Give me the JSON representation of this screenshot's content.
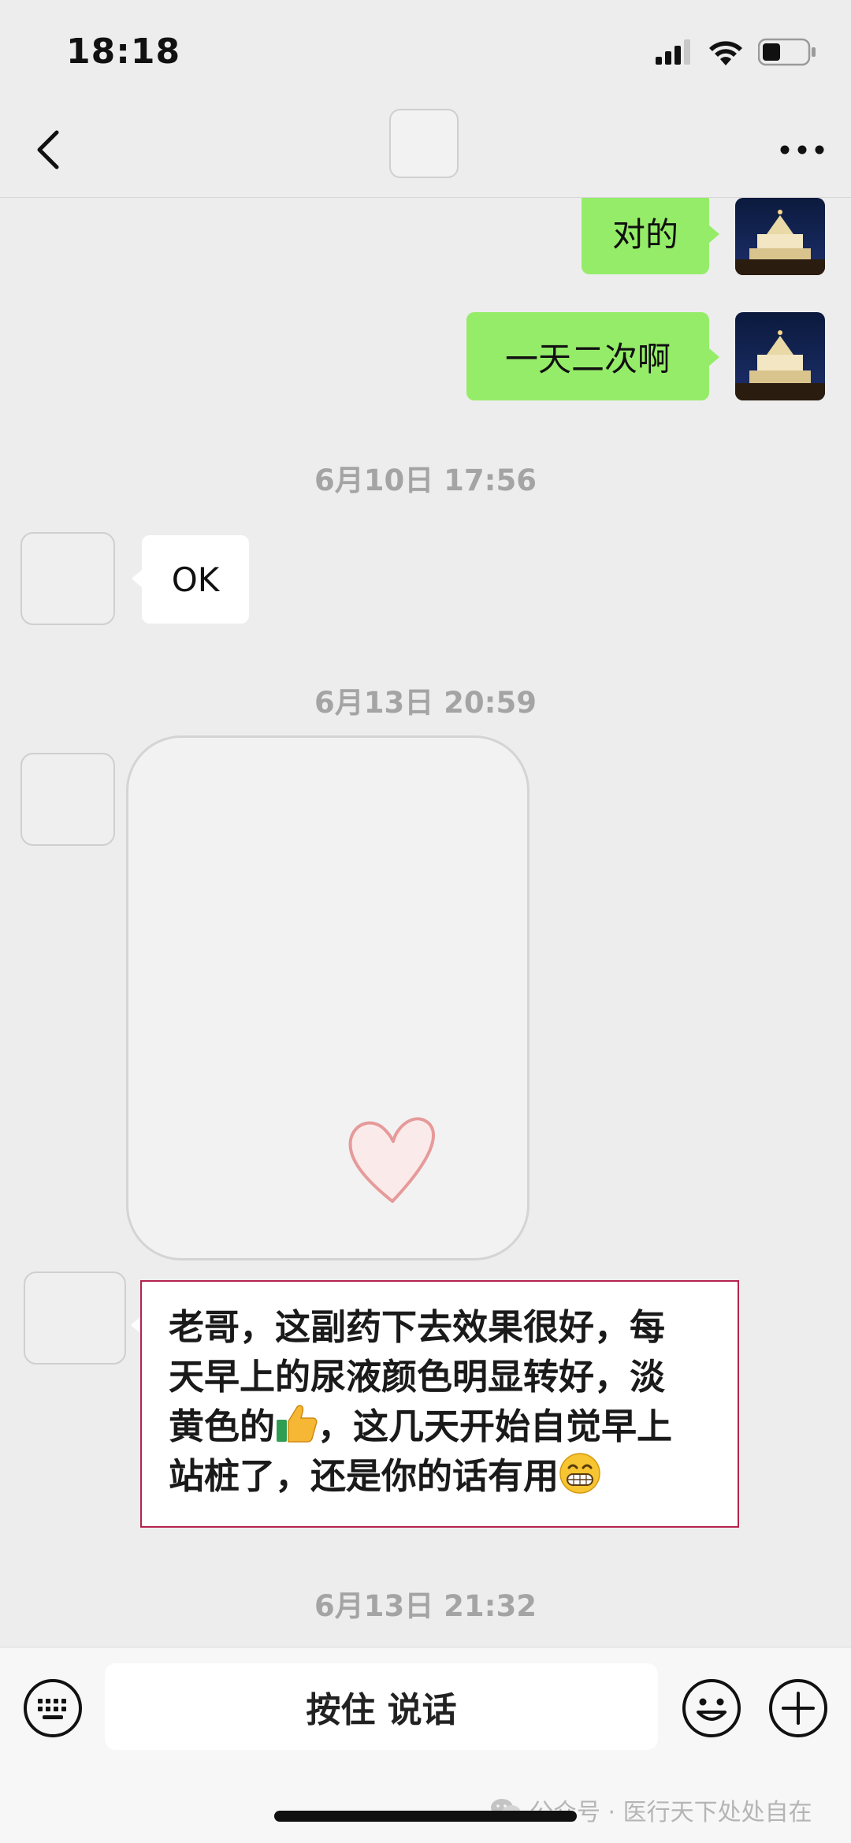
{
  "status_bar": {
    "time": "18:18",
    "signal_icon": "cellular-signal-icon",
    "wifi_icon": "wifi-icon",
    "battery_icon": "battery-icon"
  },
  "nav": {
    "back_icon": "chevron-left-icon",
    "more_icon": "more-dots-icon"
  },
  "messages": {
    "m1_text": "对的",
    "m2_text": "一天二次啊",
    "ts1": "6月10日 17:56",
    "m3_text": "OK",
    "ts2": "6月13日 20:59",
    "sticker_icon": "heart-icon",
    "m4_lines": [
      "老哥，这副药下去效果很好，每",
      "天早上的尿液颜色明显转好，淡",
      "黄色的",
      "，这几天开始自觉早上",
      "站桩了，还是你的话有用"
    ],
    "ts3": "6月13日 21:32"
  },
  "input_bar": {
    "keyboard_icon": "keyboard-icon",
    "voice_label": "按住 说话",
    "emoji_icon": "smiley-icon",
    "plus_icon": "plus-icon"
  },
  "watermark": {
    "text": "公众号 · 医行天下处处自在",
    "icon": "wechat-icon"
  },
  "colors": {
    "sent_bubble": "#95ec69",
    "received_bubble": "#ffffff",
    "background": "#ededed",
    "highlight_border": "#b6224f"
  }
}
